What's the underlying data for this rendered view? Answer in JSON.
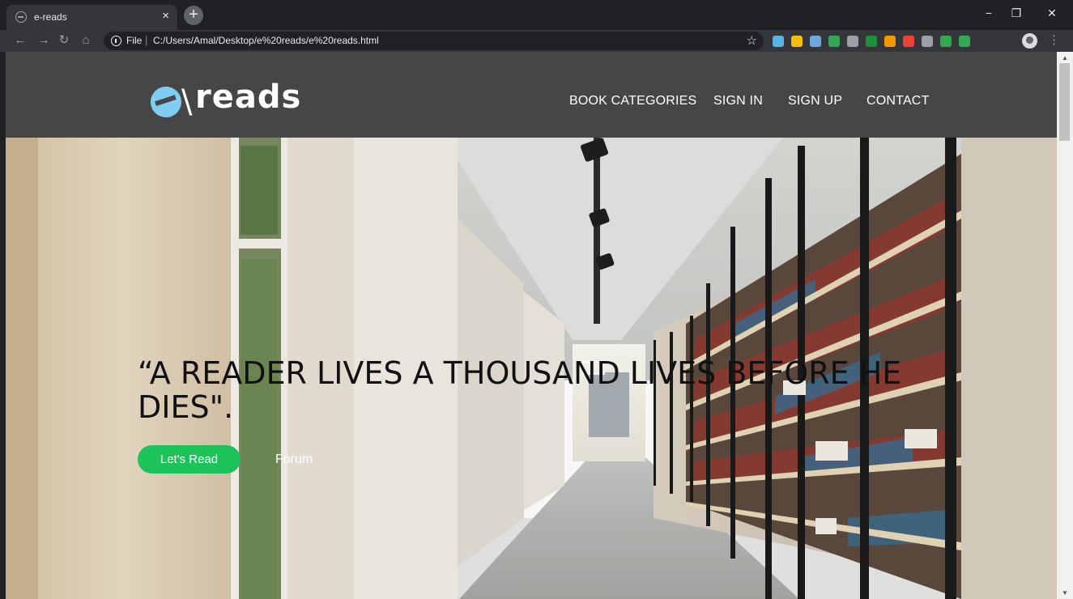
{
  "browser": {
    "tab_title": "e-reads",
    "tab_close": "×",
    "new_tab": "+",
    "url_scheme": "File",
    "url_separator": "|",
    "url": "C:/Users/Amal/Desktop/e%20reads/e%20reads.html",
    "extension_colors": [
      "#5bb2e6",
      "#fbbc04",
      "#6fa8dc",
      "#34a853",
      "#9aa0a6",
      "#1e8e3e",
      "#f29900",
      "#ea4335",
      "#9aa0a6",
      "#34a853",
      "#34a853"
    ]
  },
  "site": {
    "logo_text": "reads",
    "logo_color": "#7fcdf3",
    "header_color": "#464646",
    "nav": {
      "book_categories": "BOOK CATEGORIES",
      "sign_in": "SIGN IN",
      "sign_up": "SIGN UP",
      "contact": "CONTACT"
    },
    "hero": {
      "quote": "“A READER LIVES A THOUSAND LIVES BEFORE HE DIES\".",
      "cta_primary": "Let's Read",
      "cta_secondary": "Forum",
      "cta_color": "#1dc25a"
    }
  }
}
